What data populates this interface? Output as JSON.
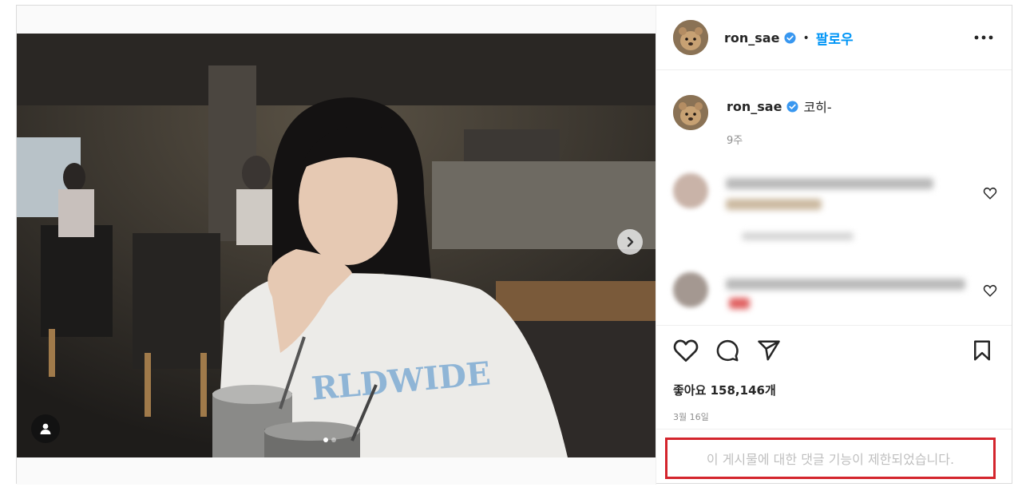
{
  "post": {
    "username": "ron_sae",
    "follow_label": "팔로우",
    "bullet": "•",
    "caption_text": "코히-",
    "caption_time": "9주",
    "likes_text": "좋아요 158,146개",
    "date": "3월 16일",
    "comments_restricted": "이 게시물에 대한 댓글 기능이 제한되었습니다."
  },
  "icons": {
    "verified": "verified-badge-icon",
    "more": "more-options-icon",
    "like": "heart-icon",
    "comment": "comment-icon",
    "share": "paper-plane-icon",
    "save": "bookmark-icon",
    "next": "chevron-right-icon",
    "tag": "user-tag-icon"
  },
  "colors": {
    "accent": "#0095f6",
    "verified": "#3897f0",
    "highlight_border": "#d4252d"
  },
  "carousel": {
    "slides": 2,
    "active_index": 0
  }
}
